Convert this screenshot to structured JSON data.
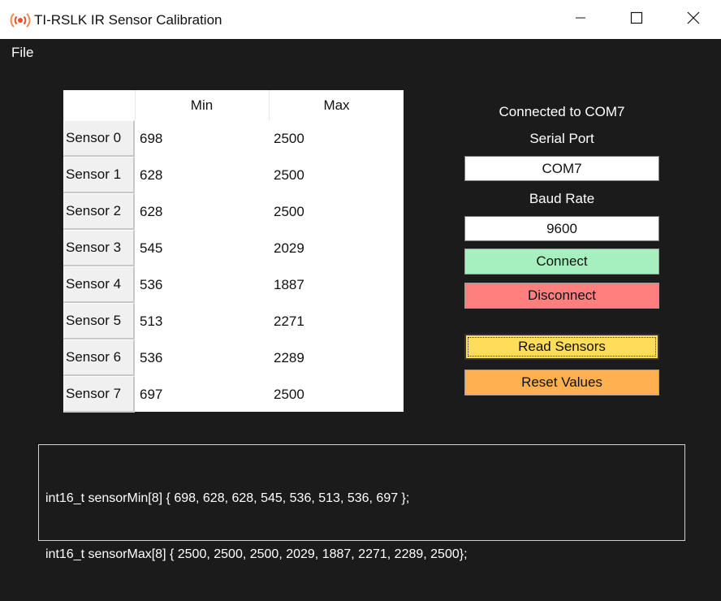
{
  "window": {
    "title": "TI-RSLK IR Sensor Calibration"
  },
  "menu": {
    "file_label": "File"
  },
  "table": {
    "headers": {
      "blank": "",
      "min": "Min",
      "max": "Max"
    },
    "rows": [
      {
        "label": "Sensor 0",
        "min": "698",
        "max": "2500"
      },
      {
        "label": "Sensor 1",
        "min": "628",
        "max": "2500"
      },
      {
        "label": "Sensor 2",
        "min": "628",
        "max": "2500"
      },
      {
        "label": "Sensor 3",
        "min": "545",
        "max": "2029"
      },
      {
        "label": "Sensor 4",
        "min": "536",
        "max": "1887"
      },
      {
        "label": "Sensor 5",
        "min": "513",
        "max": "2271"
      },
      {
        "label": "Sensor 6",
        "min": "536",
        "max": "2289"
      },
      {
        "label": "Sensor 7",
        "min": "697",
        "max": "2500"
      }
    ]
  },
  "connection": {
    "status": "Connected to COM7",
    "serial_port_label": "Serial Port",
    "serial_port_value": "COM7",
    "baud_rate_label": "Baud Rate",
    "baud_rate_value": "9600"
  },
  "buttons": {
    "connect": "Connect",
    "disconnect": "Disconnect",
    "read": "Read Sensors",
    "reset": "Reset Values"
  },
  "output": {
    "line1": "int16_t sensorMin[8] { 698, 628, 628, 545, 536, 513, 536, 697 };",
    "line2": "int16_t sensorMax[8] { 2500, 2500, 2500, 2029, 1887, 2271, 2289, 2500};"
  },
  "colors": {
    "background": "#1b1b1b",
    "connect": "#a6f0c0",
    "disconnect": "#ff7f7f",
    "read": "#ffdc5a",
    "reset": "#ffb151"
  },
  "icons": {
    "app": "broadcast-icon",
    "minimize": "minimize-icon",
    "maximize": "maximize-icon",
    "close": "close-icon"
  }
}
